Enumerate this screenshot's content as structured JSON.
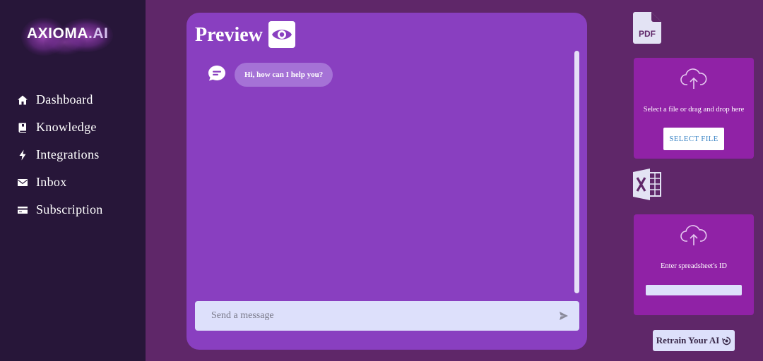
{
  "brand": {
    "name": "AXIOMA",
    "suffix": ".AI"
  },
  "sidebar": {
    "items": [
      {
        "label": "Dashboard",
        "icon": "home-icon"
      },
      {
        "label": "Knowledge",
        "icon": "book-icon"
      },
      {
        "label": "Integrations",
        "icon": "bolt-icon"
      },
      {
        "label": "Inbox",
        "icon": "mail-icon"
      },
      {
        "label": "Subscription",
        "icon": "credit-card-icon"
      }
    ]
  },
  "preview": {
    "title": "Preview",
    "title_icon": "eye-icon",
    "messages": [
      {
        "from": "bot",
        "text": "Hi, how can I help you?"
      }
    ],
    "composer": {
      "placeholder": "Send a message",
      "value": ""
    }
  },
  "uploads": {
    "pdf": {
      "icon": "pdf-file-icon",
      "icon_text": "PDF",
      "instruction": "Select a file or drag and drop here",
      "button_label": "SELECT FILE"
    },
    "spreadsheet": {
      "icon": "excel-file-icon",
      "instruction": "Enter spreadsheet's ID",
      "input_value": ""
    }
  },
  "retrain": {
    "label": "Retrain Your AI"
  },
  "colors": {
    "background": "#5f2769",
    "sidebar": "#271639",
    "preview_panel": "#893fc0",
    "upload_card": "#9022a6",
    "light_input": "#dde0fb",
    "bubble": "#a572d6"
  }
}
